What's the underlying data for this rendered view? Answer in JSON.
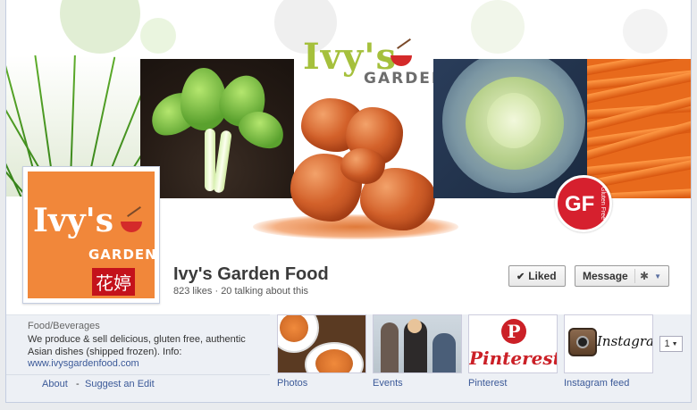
{
  "cover": {
    "logo_text": "Ivy's",
    "logo_sub": "GARDEN",
    "badge_text": "GF",
    "badge_sub": "Gluten Free"
  },
  "profile": {
    "logo_text": "Ivy's",
    "logo_sub": "GARDEN",
    "chinese": "花婷"
  },
  "page": {
    "name": "Ivy's Garden Food",
    "stats": "823 likes · 20 talking about this"
  },
  "actions": {
    "liked_label": "Liked",
    "message_label": "Message"
  },
  "about": {
    "category": "Food/Beverages",
    "description": "We produce & sell delicious, gluten free, authentic Asian dishes (shipped frozen). Info:",
    "link": "www.ivysgardenfood.com",
    "footer_about": "About",
    "footer_sep": "-",
    "footer_suggest": "Suggest an Edit"
  },
  "apps": {
    "items": [
      {
        "label": "Photos"
      },
      {
        "label": "Events"
      },
      {
        "label": "Pinterest"
      },
      {
        "label": "Instagram feed"
      }
    ],
    "more_count": "1",
    "pinterest_wordmark": "Pinterest",
    "instagram_wordmark": "Instagram"
  },
  "colors": {
    "brand_link": "#3b5998",
    "profile_bg": "#f1873a",
    "badge_red": "#d6202e"
  }
}
